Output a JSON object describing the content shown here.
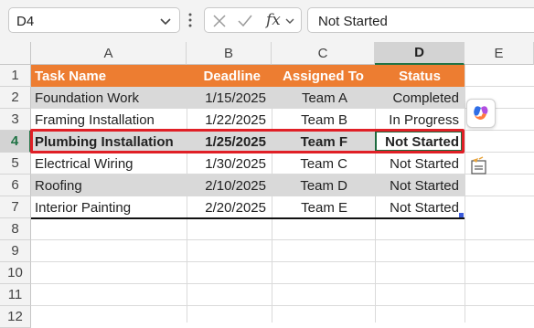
{
  "formula_bar": {
    "name_box": "D4",
    "fx_label": "fx",
    "value": "Not Started"
  },
  "columns": [
    "A",
    "B",
    "C",
    "D",
    "E"
  ],
  "selected_column": "D",
  "rows": [
    "1",
    "2",
    "3",
    "4",
    "5",
    "6",
    "7",
    "8",
    "9",
    "10",
    "11",
    "12"
  ],
  "selected_row": "4",
  "table": {
    "headers": [
      "Task Name",
      "Deadline",
      "Assigned To",
      "Status"
    ],
    "rows": [
      [
        "Foundation Work",
        "1/15/2025",
        "Team A",
        "Completed"
      ],
      [
        "Framing Installation",
        "1/22/2025",
        "Team B",
        "In Progress"
      ],
      [
        "Plumbing Installation",
        "1/25/2025",
        "Team F",
        "Not Started"
      ],
      [
        "Electrical Wiring",
        "1/30/2025",
        "Team C",
        "Not Started"
      ],
      [
        "Roofing",
        "2/10/2025",
        "Team D",
        "Not Started"
      ],
      [
        "Interior Painting",
        "2/20/2025",
        "Team E",
        "Not Started"
      ]
    ],
    "highlighted_row_index": 2
  },
  "colors": {
    "header_fill": "#ed7d31",
    "band_fill": "#d9d9d9",
    "highlight_border": "#e01f26",
    "selection": "#217346"
  },
  "icons": {
    "copilot": "copilot-icon",
    "quick_analysis": "quick-analysis-icon"
  }
}
